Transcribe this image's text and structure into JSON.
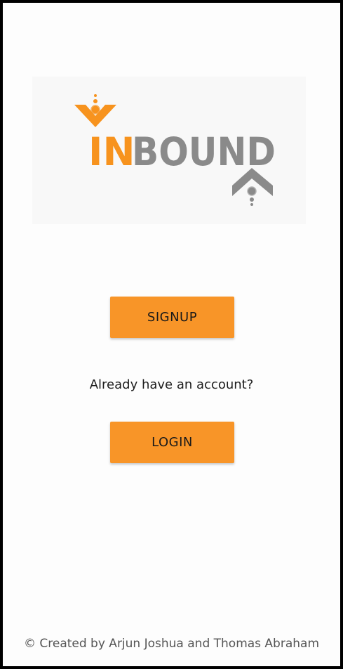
{
  "logo": {
    "text_orange": "IN",
    "text_gray": "BOUND",
    "orange": "#f7931e",
    "gray": "#8a8a8a",
    "icons": [
      "down-chevron-icon",
      "up-chevron-icon"
    ]
  },
  "actions": {
    "signup_label": "SIGNUP",
    "prompt": "Already have an account?",
    "login_label": "LOGIN",
    "button_color": "#f89528"
  },
  "footer": {
    "credit": "© Created by Arjun Joshua and Thomas Abraham"
  }
}
